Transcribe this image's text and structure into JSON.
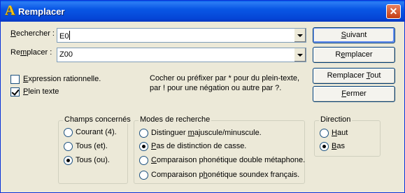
{
  "window": {
    "title": "Remplacer",
    "close_glyph": "✕",
    "app_icon": "A"
  },
  "search": {
    "label_first": "R",
    "label_rest": "echercher :",
    "value": "E0"
  },
  "replace": {
    "label_first": "R",
    "label_mid": "e",
    "label_u": "m",
    "label_rest": "placer :",
    "value": "Z00"
  },
  "buttons": {
    "next": {
      "u": "S",
      "rest": "uivant"
    },
    "replace": {
      "pre": "R",
      "u": "e",
      "rest": "mplacer"
    },
    "replace_all": {
      "pre": "Remplacer ",
      "u": "T",
      "rest": "out"
    },
    "close": {
      "u": "F",
      "rest": "ermer"
    }
  },
  "options": {
    "regex": {
      "pre": "",
      "u": "E",
      "rest": "xpression rationnelle.",
      "checked": false
    },
    "fulltext": {
      "pre": "",
      "u": "P",
      "rest": "lein texte",
      "checked": true
    }
  },
  "note": "Cocher ou préfixer par * pour du plein-texte, par ! pour une négation ou autre par ?.",
  "fields_group": {
    "legend": "Champs concernés",
    "items": [
      {
        "label": "Courant (4).",
        "selected": false
      },
      {
        "label": "Tous (et).",
        "selected": false
      },
      {
        "label": "Tous (ou).",
        "selected": true
      }
    ]
  },
  "modes_group": {
    "legend": "Modes de recherche",
    "items": [
      {
        "pre": "Distinguer ",
        "u": "m",
        "rest": "ajuscule/minuscule.",
        "selected": false
      },
      {
        "pre": "",
        "u": "P",
        "rest": "as de distinction de casse.",
        "selected": true
      },
      {
        "pre": "",
        "u": "C",
        "rest": "omparaison phonétique double métaphone.",
        "selected": false
      },
      {
        "pre": "Comparaison p",
        "u": "h",
        "rest": "onétique soundex français.",
        "selected": false
      }
    ]
  },
  "direction_group": {
    "legend": "Direction",
    "items": [
      {
        "u": "H",
        "rest": "aut",
        "selected": false
      },
      {
        "u": "B",
        "rest": "as",
        "selected": true
      }
    ]
  }
}
